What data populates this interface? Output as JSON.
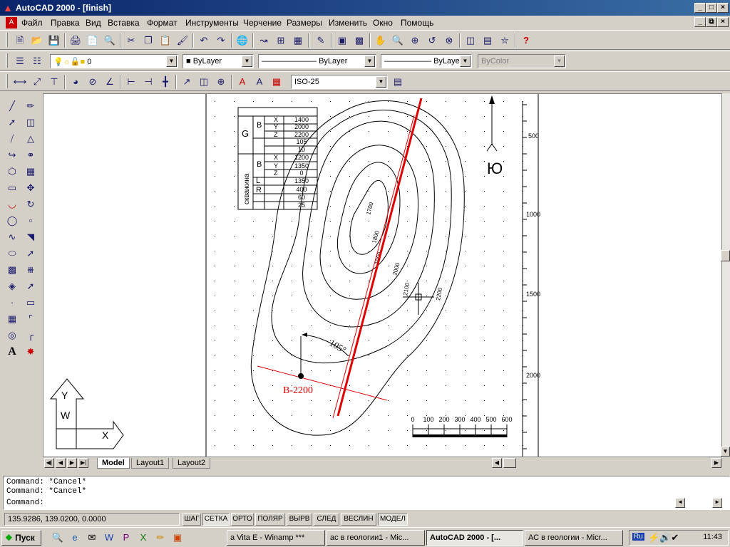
{
  "window": {
    "title": "AutoCAD 2000 - [finish]"
  },
  "menu": [
    "Файл",
    "Правка",
    "Вид",
    "Вставка",
    "Формат",
    "Инструменты",
    "Черчение",
    "Размеры",
    "Изменить",
    "Окно",
    "Помощь"
  ],
  "layers_toolbar": {
    "layer": "0",
    "color": "ByLayer",
    "linetype": "ByLayer",
    "lineweight": "ByLayer",
    "plotstyle": "ByColor"
  },
  "dim_toolbar": {
    "dimstyle": "ISO-25"
  },
  "drawing": {
    "table_rows": [
      [
        "X",
        "1400"
      ],
      [
        "Y",
        "2000"
      ],
      [
        "Z",
        "2200"
      ],
      [
        "",
        "105"
      ],
      [
        "",
        "10"
      ],
      [
        "X",
        "1200"
      ],
      [
        "Y",
        "1350"
      ],
      [
        "Z",
        "0"
      ],
      [
        "",
        "1350"
      ],
      [
        "",
        "400"
      ],
      [
        "",
        "60"
      ],
      [
        "",
        "25"
      ]
    ],
    "table_group_g": "G",
    "table_group_b1": "B",
    "table_group_b2": "B",
    "table_label_l": "L",
    "table_label_r": "R",
    "table_vertical": "скважина",
    "contour_labels": [
      "1700",
      "1800",
      "1900",
      "2000",
      "2100",
      "2200"
    ],
    "north_label": "Ю",
    "angle_label": "105°",
    "well_label": "B-2200",
    "ruler_ticks": [
      "500",
      "1000",
      "1500",
      "2000"
    ],
    "scale_labels": [
      "0",
      "100",
      "200",
      "300",
      "400",
      "500",
      "600"
    ],
    "ucs_x": "X",
    "ucs_y": "Y",
    "ucs_w": "W"
  },
  "layout_tabs": [
    "Model",
    "Layout1",
    "Layout2"
  ],
  "command_lines": [
    "Command: *Cancel*",
    "Command: *Cancel*",
    "Command:"
  ],
  "status": {
    "coords": "135.9286, 139.0200, 0.0000",
    "buttons": [
      "ШАГ",
      "СЕТКА",
      "ОРТО",
      "ПОЛЯР",
      "ВЫРВ",
      "СЛЕД",
      "ВЕСЛИН",
      "МОДЕЛ"
    ]
  },
  "taskbar": {
    "start": "Пуск",
    "tasks": [
      "a Vita E - Winamp ***",
      "ас в геологии1 - Mic...",
      "AutoCAD 2000 - [...",
      "АС в геологии - Micr..."
    ],
    "lang": "Ru",
    "clock": "11:43"
  },
  "colors": {
    "titlebar": "#0a246a",
    "wellpath": "#e00000",
    "contour": "#000000"
  }
}
